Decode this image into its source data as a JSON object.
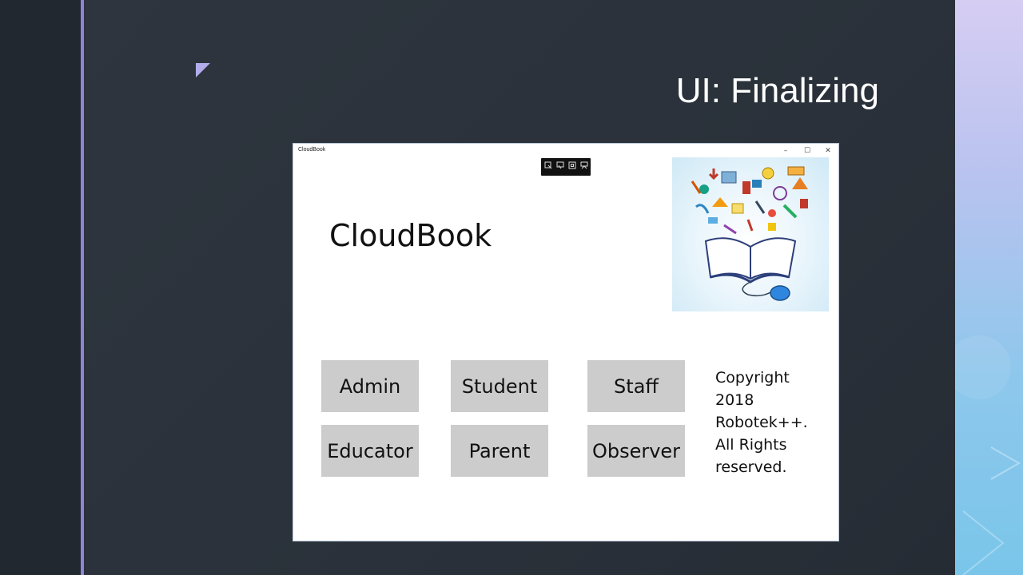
{
  "slide": {
    "title": "UI: Finalizing"
  },
  "app": {
    "window_title": "CloudBook",
    "heading": "CloudBook",
    "window_controls": {
      "minimize": "–",
      "maximize": "☐",
      "close": "✕"
    },
    "dev_toolbar_icons": [
      "select-element-icon",
      "display-layout-icon",
      "track-focus-icon",
      "adorners-icon"
    ],
    "image_subject": "education-doodles-book-mouse-image",
    "buttons": {
      "admin": "Admin",
      "student": "Student",
      "staff": "Staff",
      "educator": "Educator",
      "parent": "Parent",
      "observer": "Observer"
    },
    "copyright_lines": [
      "Copyright",
      "2018",
      "Robotek++.",
      "All Rights",
      "reserved."
    ]
  },
  "colors": {
    "slide_background": "#2c333c",
    "left_accent": "#8d86d6",
    "button_fill": "#cccccc",
    "window_background": "#ffffff"
  }
}
